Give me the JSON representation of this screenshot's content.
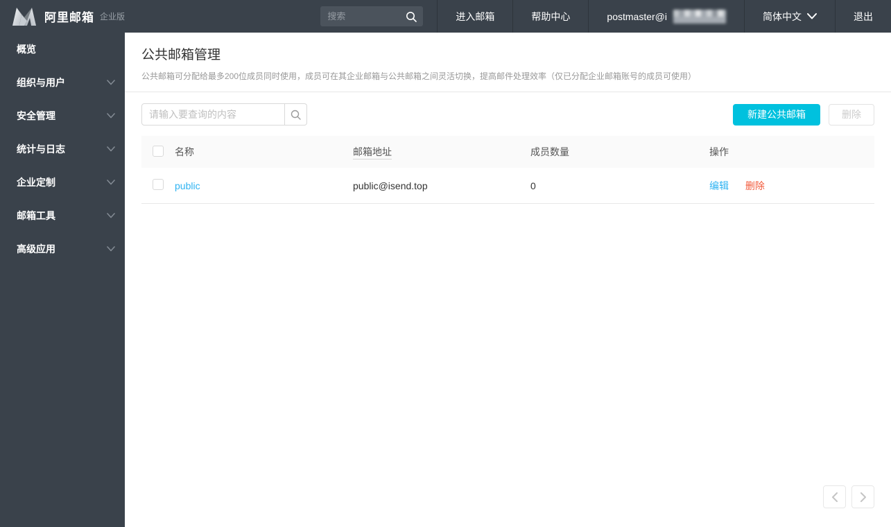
{
  "topbar": {
    "logo_text": "阿里邮箱",
    "logo_badge": "企业版",
    "search_placeholder": "搜索",
    "enter_mailbox": "进入邮箱",
    "help_center": "帮助中心",
    "account_prefix": "postmaster@i",
    "language": "简体中文",
    "logout": "退出"
  },
  "sidebar": {
    "items": [
      {
        "label": "概览",
        "has_children": false
      },
      {
        "label": "组织与用户",
        "has_children": true
      },
      {
        "label": "安全管理",
        "has_children": true
      },
      {
        "label": "统计与日志",
        "has_children": true
      },
      {
        "label": "企业定制",
        "has_children": true
      },
      {
        "label": "邮箱工具",
        "has_children": true
      },
      {
        "label": "高级应用",
        "has_children": true
      }
    ]
  },
  "main": {
    "title": "公共邮箱管理",
    "subtitle": "公共邮箱可分配给最多200位成员同时使用，成员可在其企业邮箱与公共邮箱之间灵活切换，提高邮件处理效率（仅已分配企业邮箱账号的成员可使用）",
    "query_placeholder": "请输入要查询的内容",
    "create_button": "新建公共邮箱",
    "delete_button": "删除",
    "table": {
      "columns": {
        "name": "名称",
        "address": "邮箱地址",
        "members": "成员数量",
        "actions": "操作"
      },
      "rows": [
        {
          "name": "public",
          "address": "public@isend.top",
          "members": "0",
          "edit": "编辑",
          "delete": "删除"
        }
      ]
    }
  },
  "colors": {
    "topbar_bg": "#3a424b",
    "primary": "#00c1de",
    "link": "#2fb3f2",
    "danger": "#f2593a"
  }
}
